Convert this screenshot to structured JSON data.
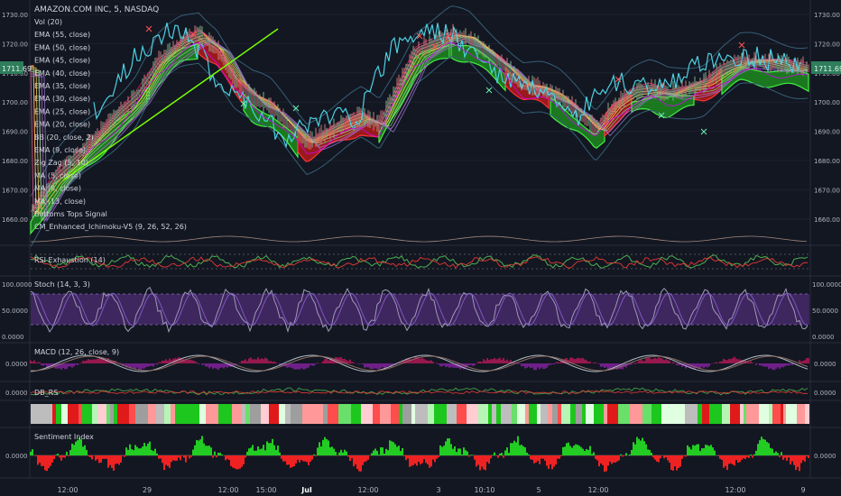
{
  "symbol": "AMAZON.COM INC, 5, NASDAQ",
  "last_price": "1711.69",
  "main_indicators": [
    "Vol (20)",
    "EMA (55, close)",
    "EMA (50, close)",
    "EMA (45, close)",
    "EMA (40, close)",
    "EMA (35, close)",
    "EMA (30, close)",
    "EMA (25, close)",
    "EMA (20, close)",
    "BB (20, close, 2)",
    "EMA (9, close)",
    "Zig Zag (5, 10)",
    "MA (5, close)",
    "MA (8, close)",
    "MA (13, close)",
    "Bottoms Tops Signal",
    "CM_Enhanced_Ichimoku-V5 (9, 26, 52, 26)"
  ],
  "price_axis": [
    "1730.00",
    "1720.00",
    "1710.00",
    "1700.00",
    "1690.00",
    "1680.00",
    "1670.00",
    "1660.00"
  ],
  "panels": {
    "rsi": {
      "label": "RSI Exhaustion (14)"
    },
    "stoch": {
      "label": "Stoch (14, 3, 3)",
      "axis": [
        "100.0000",
        "50.0000",
        "0.0000"
      ]
    },
    "macd": {
      "label": "MACD (12, 26, close, 9)",
      "axis": [
        "0.0000"
      ]
    },
    "dbrs": {
      "label": "DB_RS",
      "axis": [
        "0.0000"
      ]
    },
    "sentiment": {
      "label": "Sentiment Index",
      "axis": [
        "0.0000"
      ]
    }
  },
  "time_axis": [
    "12:00",
    "29",
    "12:00",
    "15:00",
    "Jul",
    "12:00",
    "3",
    "10:10",
    "5",
    "12:00",
    "12:00",
    "9"
  ],
  "colors": {
    "background": "#131722",
    "ichimoku_bull": "#33dd33",
    "ichimoku_bear": "#ee2222",
    "close_line": "#4dd0e1",
    "stoch_fill": "#4a2a6e",
    "sentiment_pos": "#22cc22",
    "sentiment_neg": "#ee2222"
  }
}
